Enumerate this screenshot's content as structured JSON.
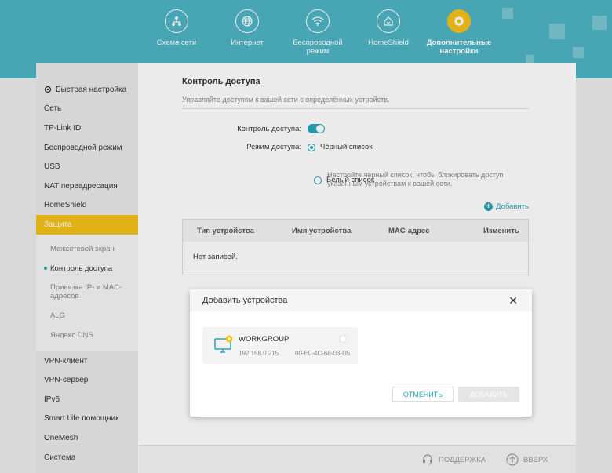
{
  "nav": {
    "items": [
      {
        "label": "Схема сети",
        "icon": "network-map-icon"
      },
      {
        "label": "Интернет",
        "icon": "globe-icon"
      },
      {
        "label": "Беспроводной режим",
        "icon": "wifi-icon"
      },
      {
        "label": "HomeShield",
        "icon": "home-shield-icon"
      },
      {
        "label": "Дополнительные настройки",
        "icon": "gear-icon"
      }
    ]
  },
  "sidebar": {
    "items": [
      {
        "label": "Быстрая настройка"
      },
      {
        "label": "Сеть"
      },
      {
        "label": "TP-Link ID"
      },
      {
        "label": "Беспроводной режим"
      },
      {
        "label": "USB"
      },
      {
        "label": "NAT переадресация"
      },
      {
        "label": "HomeShield"
      },
      {
        "label": "Защита"
      }
    ],
    "sub": [
      {
        "label": "Межсетевой экран"
      },
      {
        "label": "Контроль доступа"
      },
      {
        "label": "Привязка IP- и MAC-адресов"
      },
      {
        "label": "ALG"
      },
      {
        "label": "Яндекс.DNS"
      }
    ],
    "bottom": [
      {
        "label": "VPN-клиент"
      },
      {
        "label": "VPN-сервер"
      },
      {
        "label": "IPv6"
      },
      {
        "label": "Smart Life помощник"
      },
      {
        "label": "OneMesh"
      },
      {
        "label": "Система"
      }
    ]
  },
  "content": {
    "title": "Контроль доступа",
    "subtitle": "Управляйте доступом к вашей сети с определённых устройств.",
    "access_label": "Контроль доступа:",
    "mode_label": "Режим доступа:",
    "blacklist": "Чёрный список",
    "hint": "Настройте черный список, чтобы блокировать доступ указанным устройствам к вашей сети.",
    "whitelist": "Белый список",
    "add_link": "Добавить",
    "table": {
      "headers": [
        "Тип устройства",
        "Имя устройства",
        "MAC-адрес",
        "Изменить"
      ],
      "empty": "Нет записей."
    }
  },
  "modal": {
    "title": "Добавить устройства",
    "device": {
      "name": "WORKGROUP",
      "ip": "192.168.0.215",
      "mac": "00-E0-4C-68-03-D5"
    },
    "cancel": "ОТМЕНИТЬ",
    "add": "ДОБАВИТЬ"
  },
  "footer": {
    "support": "ПОДДЕРЖКА",
    "up": "ВВЕРХ"
  },
  "colors": {
    "header": "#4fb4c4",
    "accent": "#2aa5b8",
    "active": "#f3c21b"
  }
}
